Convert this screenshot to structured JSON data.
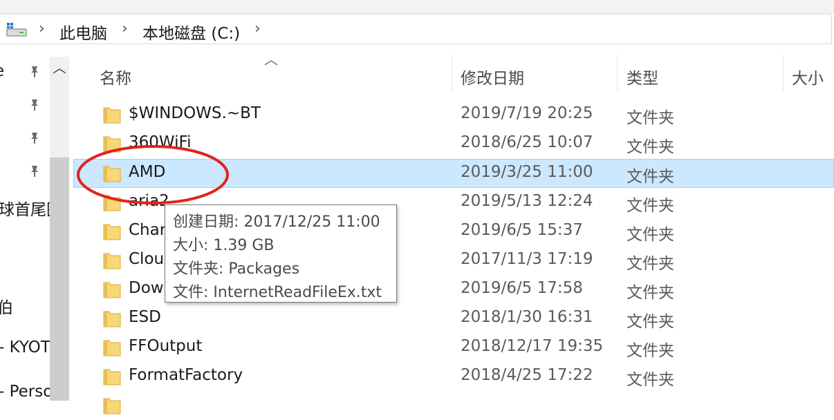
{
  "breadcrumb": {
    "items": [
      "此电脑",
      "本地磁盘 (C:)"
    ]
  },
  "nav": {
    "items": [
      "e",
      "球首尾图",
      "伯",
      "- KYOT",
      "- Perso"
    ]
  },
  "columns": {
    "name": "名称",
    "date_modified": "修改日期",
    "type": "类型",
    "size": "大小"
  },
  "files": [
    {
      "name": "$WINDOWS.~BT",
      "date": "2019/7/19 20:25",
      "type": "文件夹"
    },
    {
      "name": "360WiFi",
      "date": "2018/6/25 10:07",
      "type": "文件夹"
    },
    {
      "name": "AMD",
      "date": "2019/3/25 11:00",
      "type": "文件夹"
    },
    {
      "name": "aria2",
      "date": "2019/5/13 12:24",
      "type": "文件夹"
    },
    {
      "name": "Char",
      "date": "2019/6/5 15:37",
      "type": "文件夹"
    },
    {
      "name": "Clou",
      "date": "2017/11/3 17:19",
      "type": "文件夹"
    },
    {
      "name": "Dow",
      "date": "2019/6/5 17:58",
      "type": "文件夹"
    },
    {
      "name": "ESD",
      "date": "2018/1/30 16:31",
      "type": "文件夹"
    },
    {
      "name": "FFOutput",
      "date": "2018/12/17 19:35",
      "type": "文件夹"
    },
    {
      "name": "FormatFactory",
      "date": "2018/4/25 17:22",
      "type": "文件夹"
    }
  ],
  "selected_file": "AMD",
  "tooltip": {
    "lines": [
      "创建日期: 2017/12/25 11:00",
      "大小: 1.39 GB",
      "文件夹: Packages",
      "文件: InternetReadFileEx.txt"
    ]
  },
  "colors": {
    "selection": "#cce8ff",
    "selection_border": "#99d1ff",
    "annotation": "#e0241b",
    "folder": "#f8d775"
  },
  "icons": {
    "drive": "drive-icon",
    "folder": "folder-icon",
    "pin": "pin-icon",
    "separator": "chevron-right-icon",
    "sort": "sort-ascending-icon",
    "scroll_up": "scroll-up-icon"
  }
}
